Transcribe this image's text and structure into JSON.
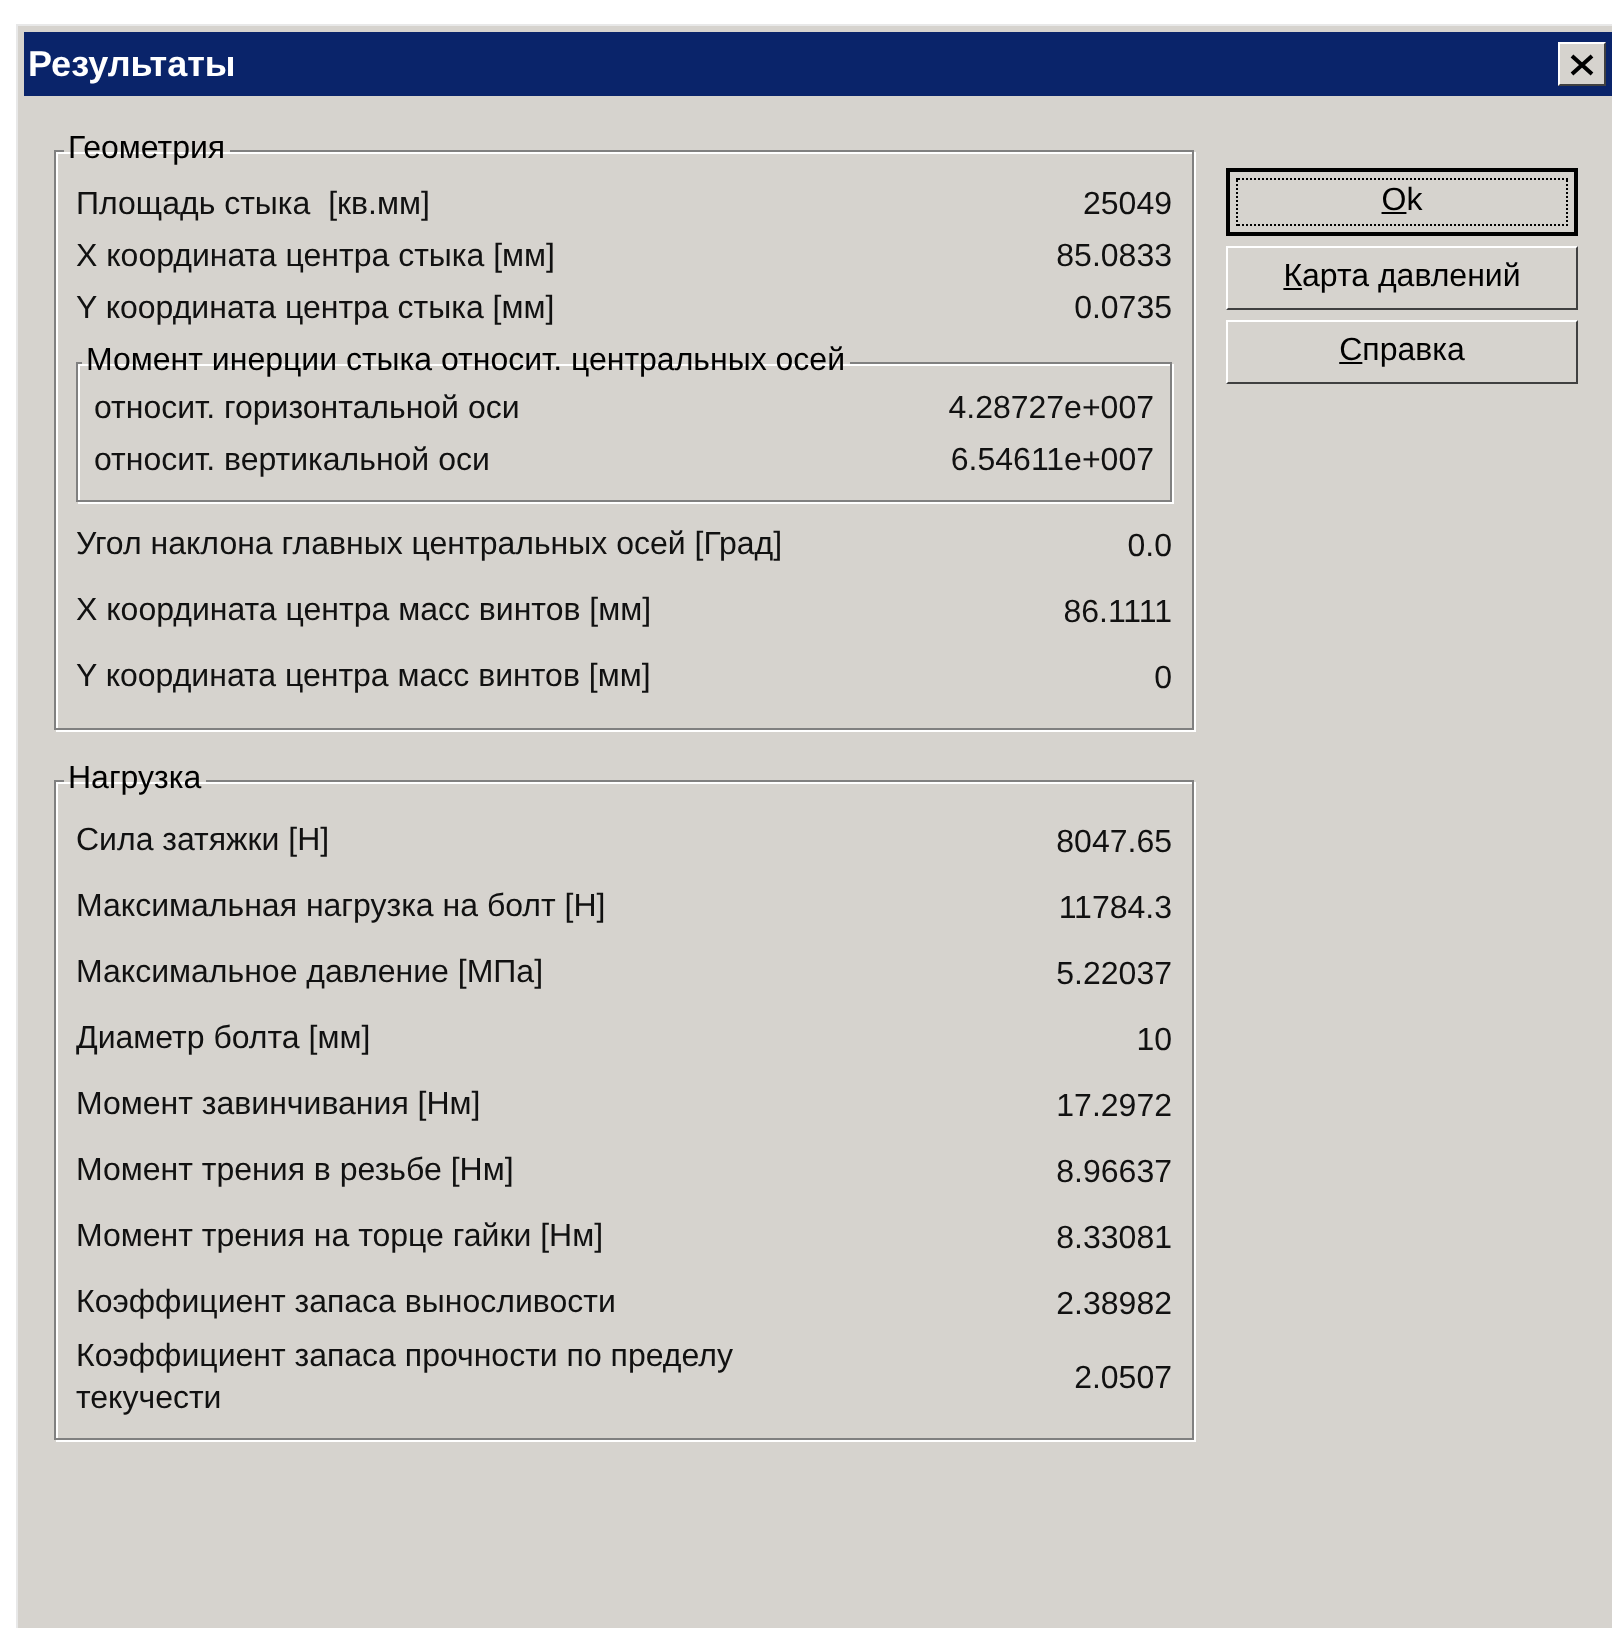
{
  "window": {
    "title": "Результаты"
  },
  "geometry": {
    "title": "Геометрия",
    "rows": [
      {
        "label": "Площадь стыка  [кв.мм]",
        "value": "25049"
      },
      {
        "label": "X координата центра стыка [мм]",
        "value": "85.0833"
      },
      {
        "label": "Y координата центра стыка [мм]",
        "value": "0.0735"
      }
    ],
    "inertia": {
      "title": "Момент инерции стыка относит. центральных осей",
      "rows": [
        {
          "label": "относит. горизонтальной оси",
          "value": "4.28727e+007"
        },
        {
          "label": "относит. вертикальной оси",
          "value": "6.54611e+007"
        }
      ]
    },
    "rows_after": [
      {
        "label": "Угол наклона главных центральных осей [Град]",
        "value": "0.0"
      },
      {
        "label": "X координата центра масс винтов [мм]",
        "value": "86.1111"
      },
      {
        "label": "Y координата центра масс винтов [мм]",
        "value": "0"
      }
    ]
  },
  "load": {
    "title": "Нагрузка",
    "rows": [
      {
        "label": "Сила затяжки [Н]",
        "value": "8047.65"
      },
      {
        "label": "Максимальная нагрузка на болт [Н]",
        "value": "11784.3"
      },
      {
        "label": "Максимальное давление [МПа]",
        "value": "5.22037"
      },
      {
        "label": "Диаметр болта [мм]",
        "value": "10"
      },
      {
        "label": "Момент завинчивания [Нм]",
        "value": "17.2972"
      },
      {
        "label": "Момент трения в резьбе [Нм]",
        "value": "8.96637"
      },
      {
        "label": "Момент трения на торце гайки [Нм]",
        "value": "8.33081"
      },
      {
        "label": "Коэффициент запаса выносливости",
        "value": "2.38982"
      },
      {
        "label": "Коэффициент запаса прочности по пределу текучести",
        "value": "2.0507"
      }
    ]
  },
  "buttons": [
    {
      "label": "Ok",
      "default": true
    },
    {
      "label": "Карта давлений",
      "default": false
    },
    {
      "label": "Справка",
      "default": false
    }
  ]
}
